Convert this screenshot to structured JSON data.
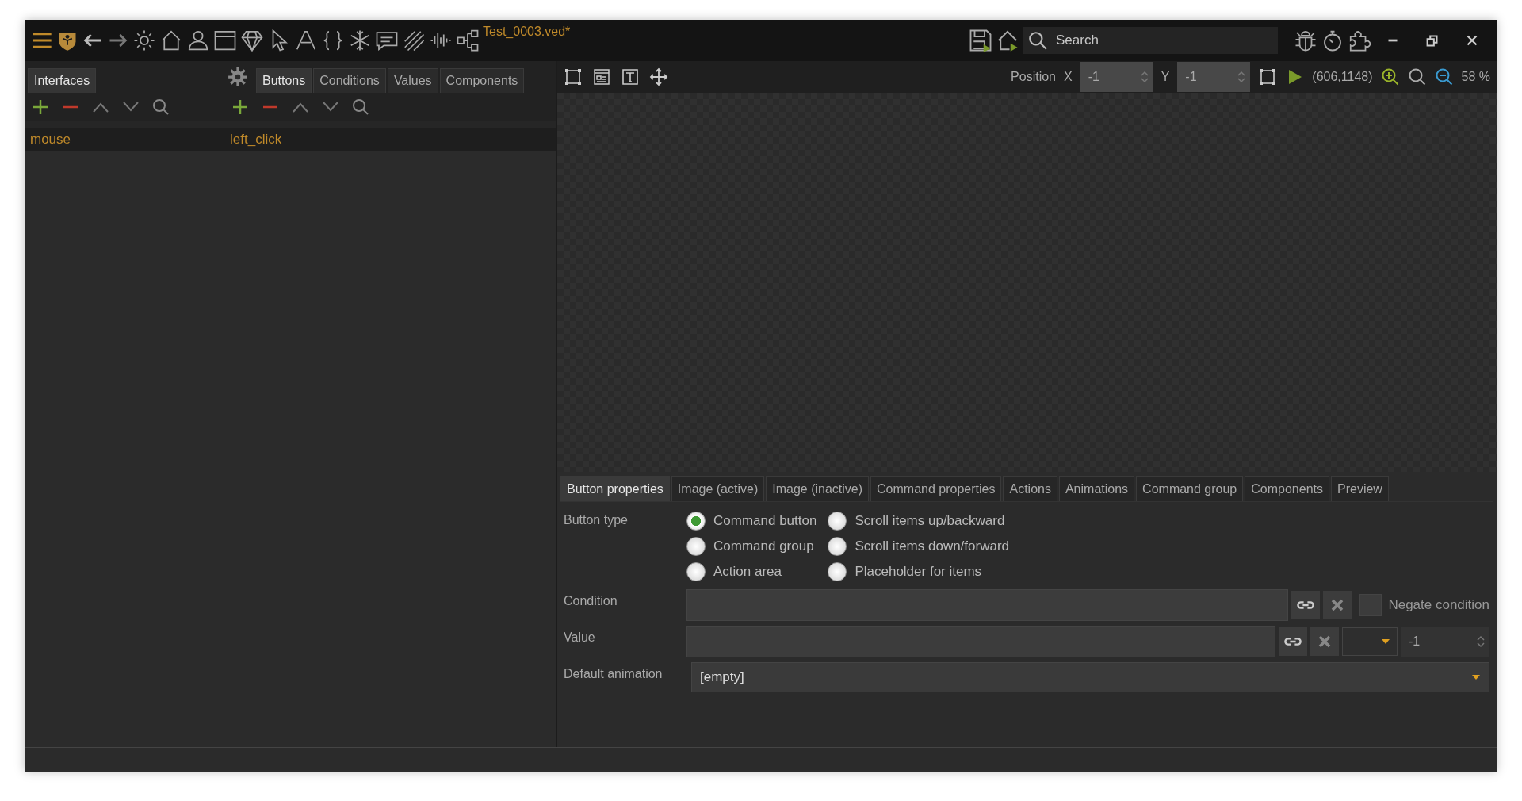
{
  "window": {
    "title": "Test_0003.ved*"
  },
  "search": {
    "placeholder": "Search"
  },
  "left_tabs": [
    {
      "label": "Interfaces",
      "selected": true
    }
  ],
  "mid_tabs": [
    {
      "label": "Buttons",
      "selected": true
    },
    {
      "label": "Conditions",
      "selected": false
    },
    {
      "label": "Values",
      "selected": false
    },
    {
      "label": "Components",
      "selected": false
    }
  ],
  "interfaces": [
    {
      "label": "mouse",
      "selected": true
    }
  ],
  "buttons": [
    {
      "label": "left_click",
      "selected": true
    }
  ],
  "canvas_toolbar": {
    "position_label": "Position",
    "x_label": "X",
    "x_value": "-1",
    "y_label": "Y",
    "y_value": "-1",
    "coords": "(606,1148)",
    "zoom": "58 %"
  },
  "property_tabs": [
    {
      "label": "Button properties",
      "selected": true
    },
    {
      "label": "Image (active)",
      "selected": false
    },
    {
      "label": "Image (inactive)",
      "selected": false
    },
    {
      "label": "Command properties",
      "selected": false
    },
    {
      "label": "Actions",
      "selected": false
    },
    {
      "label": "Animations",
      "selected": false
    },
    {
      "label": "Command group",
      "selected": false
    },
    {
      "label": "Components",
      "selected": false
    },
    {
      "label": "Preview",
      "selected": false
    }
  ],
  "button_type": {
    "label": "Button type",
    "options": [
      {
        "label": "Command button",
        "selected": true
      },
      {
        "label": "Command group",
        "selected": false
      },
      {
        "label": "Action area",
        "selected": false
      },
      {
        "label": "Scroll items up/backward",
        "selected": false
      },
      {
        "label": "Scroll items down/forward",
        "selected": false
      },
      {
        "label": "Placeholder for items",
        "selected": false
      }
    ]
  },
  "condition": {
    "label": "Condition",
    "negate_label": "Negate condition",
    "negate_checked": false
  },
  "value": {
    "label": "Value",
    "number": "-1"
  },
  "default_animation": {
    "label": "Default animation",
    "value": "[empty]"
  }
}
